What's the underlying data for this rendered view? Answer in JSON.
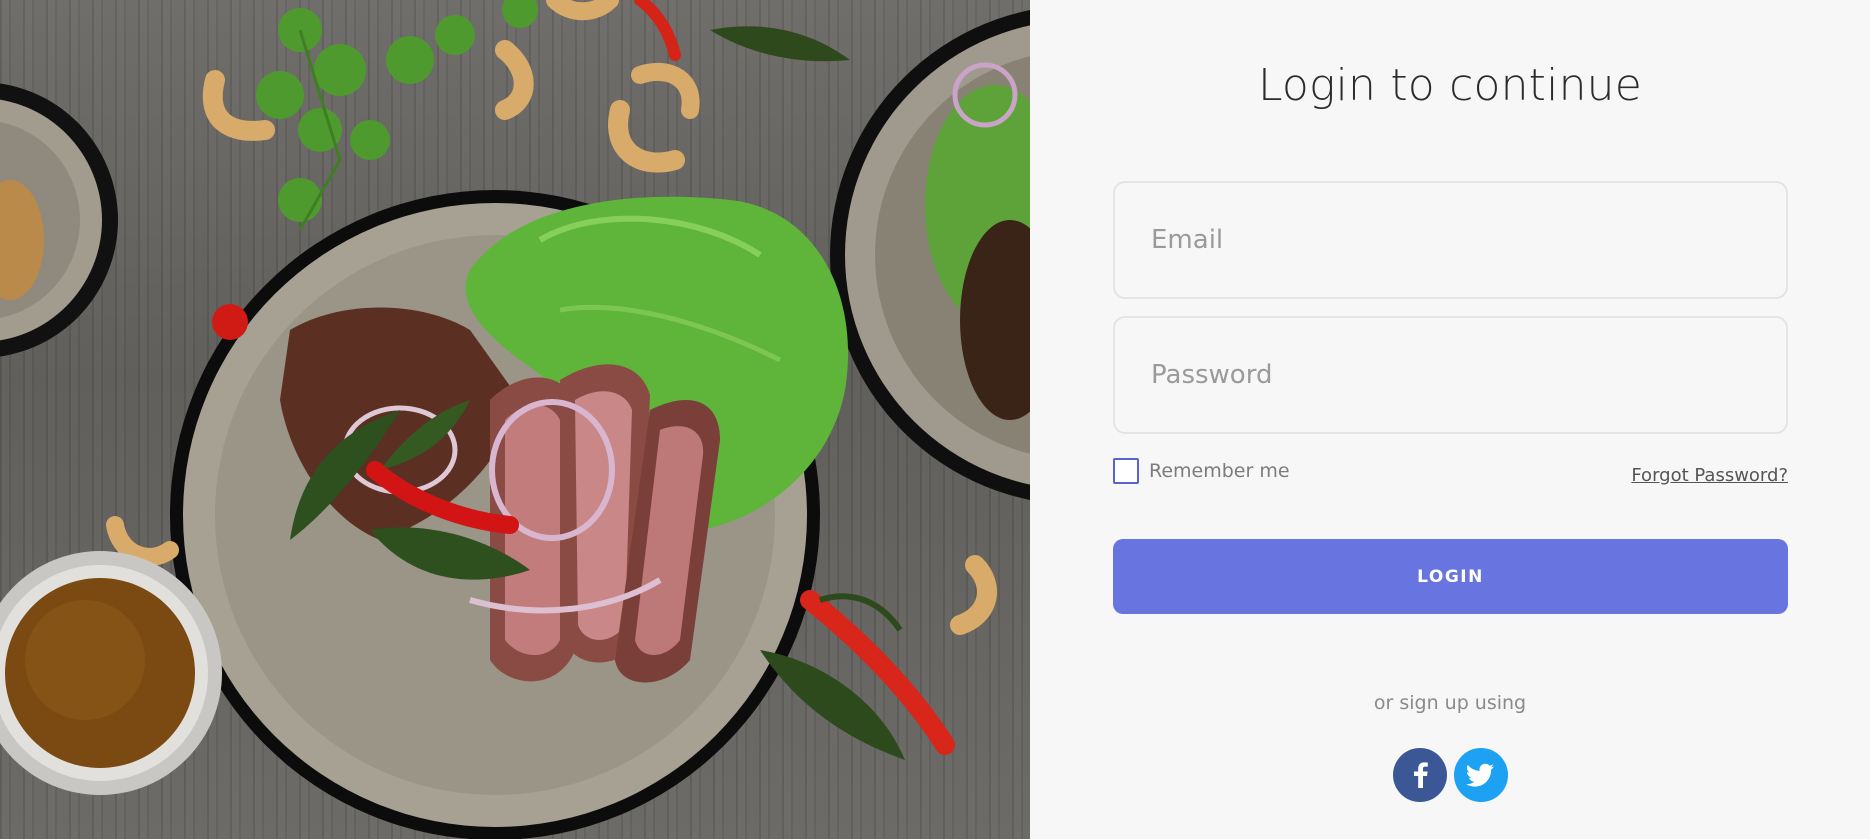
{
  "login": {
    "title": "Login to continue",
    "email_placeholder": "Email",
    "password_placeholder": "Password",
    "remember_label": "Remember me",
    "forgot_label": "Forgot Password?",
    "login_label": "LOGIN",
    "signup_text": "or sign up using"
  },
  "social": [
    {
      "name": "facebook-icon",
      "color": "#3b5795"
    },
    {
      "name": "twitter-icon",
      "color": "#1da1f2"
    }
  ],
  "colors": {
    "accent": "#6874e0",
    "checkbox_border": "#5a63c9",
    "panel_bg": "#f7f7f7"
  }
}
